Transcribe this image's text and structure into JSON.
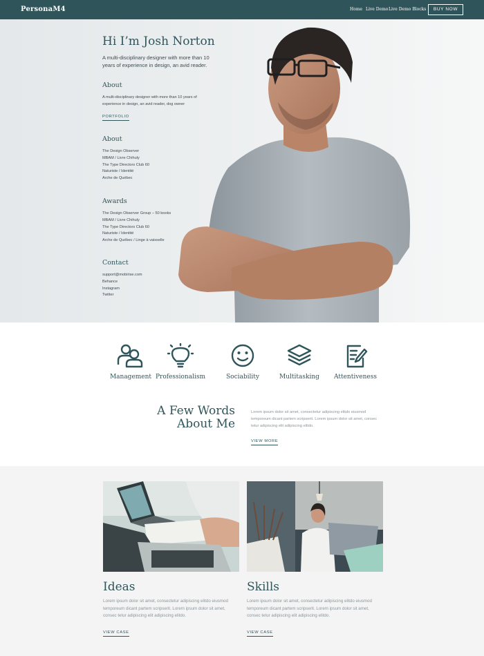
{
  "navbar": {
    "brand": "PersonaM4",
    "links": [
      "Home",
      "Live Demo",
      "Live Demo Blocks"
    ],
    "buy_button": "BUY NOW"
  },
  "hero": {
    "title": "Hi I’m Josh Norton",
    "lead": "A multi-disciplinary designer with more than 10 years of experience in design, an avid reader.",
    "about1": {
      "heading": "About",
      "text": "A multi-disciplinary designer with more than 10 years of experience in design, an avid reader, dog owner",
      "link": "PORTFOLIO"
    },
    "about2": {
      "heading": "About",
      "items": [
        "The Design Observer",
        "MBAM / Livre Chihuly",
        "The Type Directors Club 60",
        "Naturiste / Identité",
        "Arche de Québec"
      ]
    },
    "awards": {
      "heading": "Awards",
      "items": [
        "The Design Observer Group – 50 books",
        "MBAM / Livre Chihuly",
        "The Type Directors Club 60",
        "Naturiste / Identité",
        "Arche de Québec / Linge à vaisselle"
      ]
    },
    "contact": {
      "heading": "Contact",
      "items": [
        "support@mobirise.com",
        "Behance",
        "Instagram",
        "Twitter"
      ]
    }
  },
  "features": [
    {
      "label": "Management",
      "icon": "people-icon"
    },
    {
      "label": "Professionalism",
      "icon": "lightbulb-icon"
    },
    {
      "label": "Sociability",
      "icon": "smiley-icon"
    },
    {
      "label": "Multitasking",
      "icon": "layers-icon"
    },
    {
      "label": "Attentiveness",
      "icon": "notepad-icon"
    }
  ],
  "words": {
    "title_line1": "A Few Words",
    "title_line2": "About Me",
    "text": "Lorem ipsum dolor sit amet, consectetur adipiscing elitdo eiusmod temporeum dicant partem scripserit. Lorem ipsum dolor sit amet, consec tetur adipiscing elit adipiscing elitdo.",
    "link": "VIEW MORE"
  },
  "cards": [
    {
      "title": "Ideas",
      "text": "Lorem ipsum dolor sit amet, consectetur adipiscing elitdo eiusmod temporeum dicant partem scripserit. Lorem ipsum dolor sit amet, consec tetur adipiscing elit adipiscing elitdo.",
      "link": "VIEW CASE"
    },
    {
      "title": "Skills",
      "text": "Lorem ipsum dolor sit amet, consectetur adipiscing elitdo eiusmod temporeum dicant partem scripserit. Lorem ipsum dolor sit amet, consec tetur adipiscing elit adipiscing elitdo.",
      "link": "VIEW CASE"
    }
  ],
  "colors": {
    "brand_teal": "#2f555b",
    "section_gray": "#f4f4f4",
    "muted_text": "#8a969b"
  }
}
